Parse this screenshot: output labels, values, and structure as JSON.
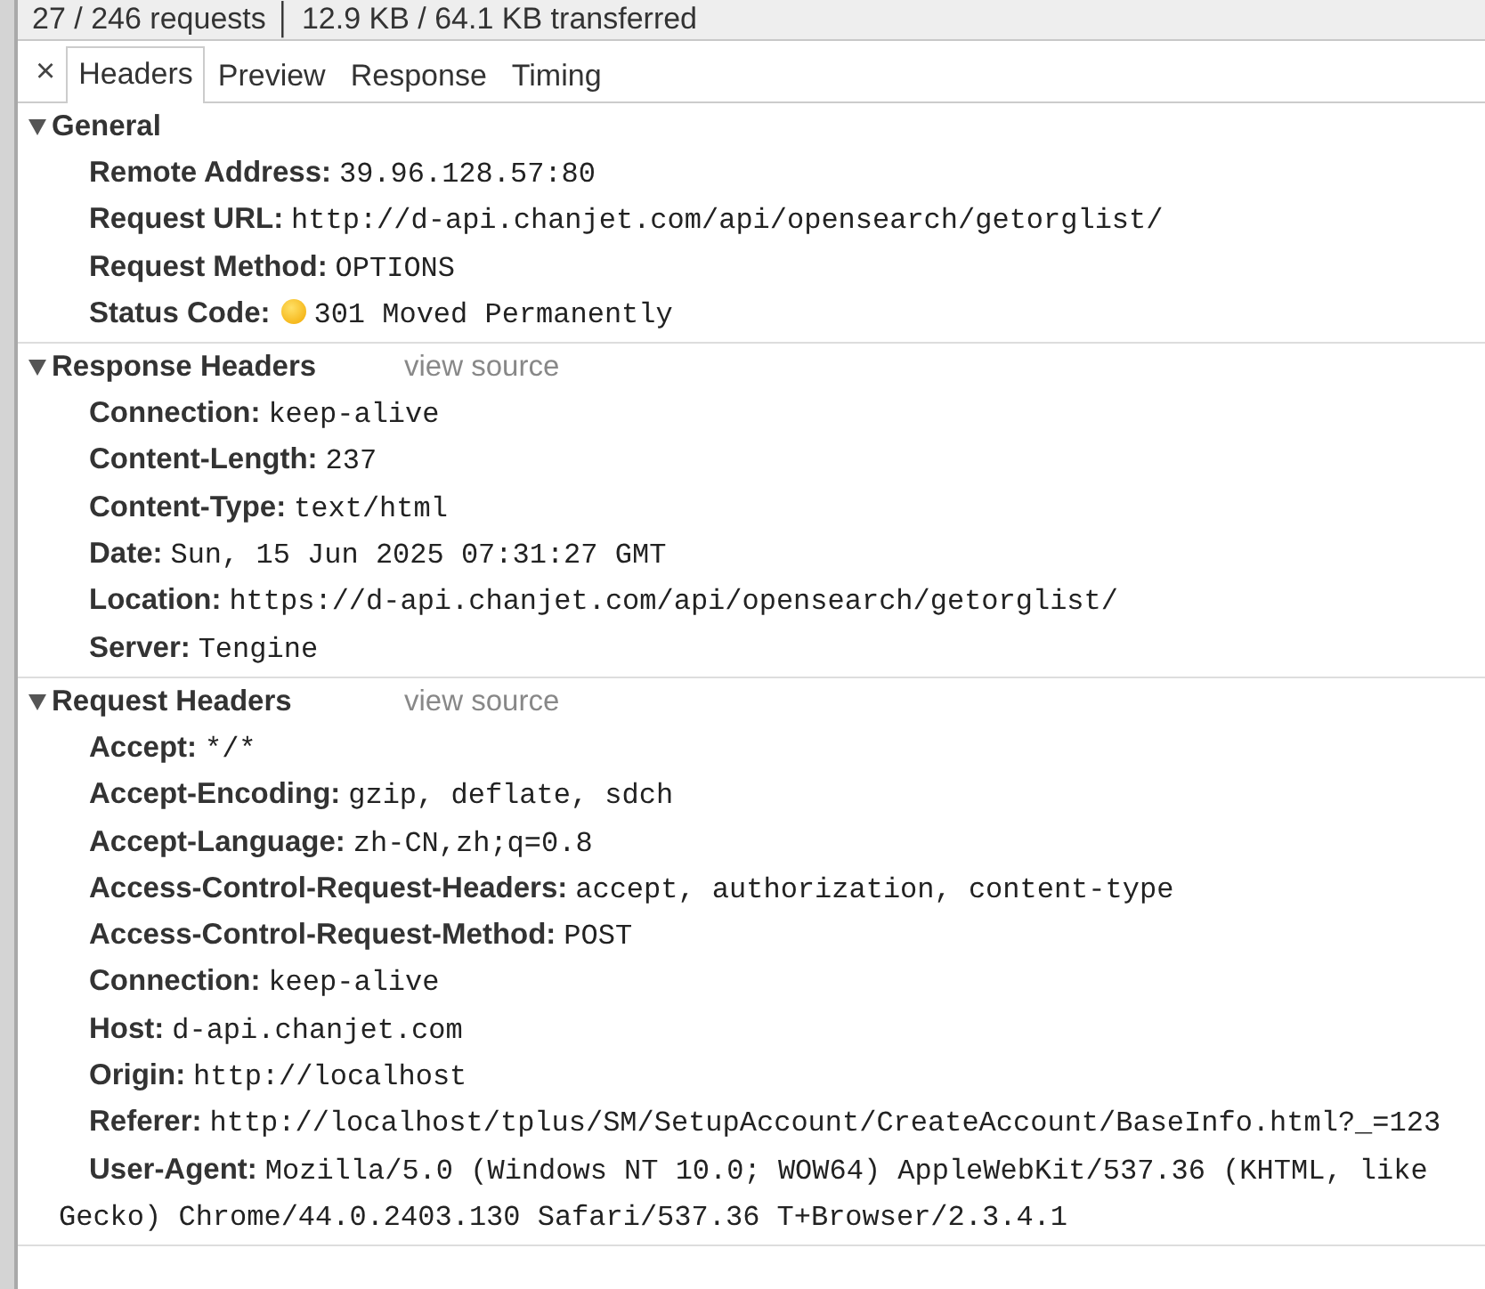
{
  "summary_bar": {
    "text": "27 / 246 requests │ 12.9 KB / 64.1 KB transferred"
  },
  "tab_bar": {
    "close": "×",
    "tabs": [
      {
        "label": "Headers",
        "selected": true
      },
      {
        "label": "Preview",
        "selected": false
      },
      {
        "label": "Response",
        "selected": false
      },
      {
        "label": "Timing",
        "selected": false
      }
    ]
  },
  "sections": [
    {
      "title": "General",
      "expanded": true,
      "rows": [
        {
          "name": "Remote Address:",
          "value": "39.96.128.57:80"
        },
        {
          "name": "Request URL:",
          "value": "http://d-api.chanjet.com/api/opensearch/getorglist/"
        },
        {
          "name": "Request Method:",
          "value": "OPTIONS"
        },
        {
          "name": "Status Code:",
          "value": "301 Moved Permanently",
          "kind": "status"
        }
      ]
    },
    {
      "title": "Response Headers",
      "expanded": true,
      "link": "view source",
      "rows": [
        {
          "name": "Connection:",
          "value": "keep-alive"
        },
        {
          "name": "Content-Length:",
          "value": "237"
        },
        {
          "name": "Content-Type:",
          "value": "text/html"
        },
        {
          "name": "Date:",
          "value": "Sun, 15 Jun 2025 07:31:27 GMT"
        },
        {
          "name": "Location:",
          "value": "https://d-api.chanjet.com/api/opensearch/getorglist/"
        },
        {
          "name": "Server:",
          "value": "Tengine"
        }
      ]
    },
    {
      "title": "Request Headers",
      "expanded": true,
      "link": "view source",
      "rows": [
        {
          "name": "Accept:",
          "value": "*/*"
        },
        {
          "name": "Accept-Encoding:",
          "value": "gzip, deflate, sdch"
        },
        {
          "name": "Accept-Language:",
          "value": "zh-CN,zh;q=0.8"
        },
        {
          "name": "Access-Control-Request-Headers:",
          "value": "accept, authorization, content-type"
        },
        {
          "name": "Access-Control-Request-Method:",
          "value": "POST"
        },
        {
          "name": "Connection:",
          "value": "keep-alive"
        },
        {
          "name": "Host:",
          "value": "d-api.chanjet.com"
        },
        {
          "name": "Origin:",
          "value": "http://localhost"
        },
        {
          "name": "Referer:",
          "value": "http://localhost/tplus/SM/SetupAccount/CreateAccount/BaseInfo.html?_=123"
        },
        {
          "name": "User-Agent:",
          "value": "Mozilla/5.0 (Windows NT 10.0; WOW64) AppleWebKit/537.36 (KHTML, like Gecko) Chrome/44.0.2403.130 Safari/537.36 T+Browser/2.3.4.1"
        }
      ]
    }
  ]
}
